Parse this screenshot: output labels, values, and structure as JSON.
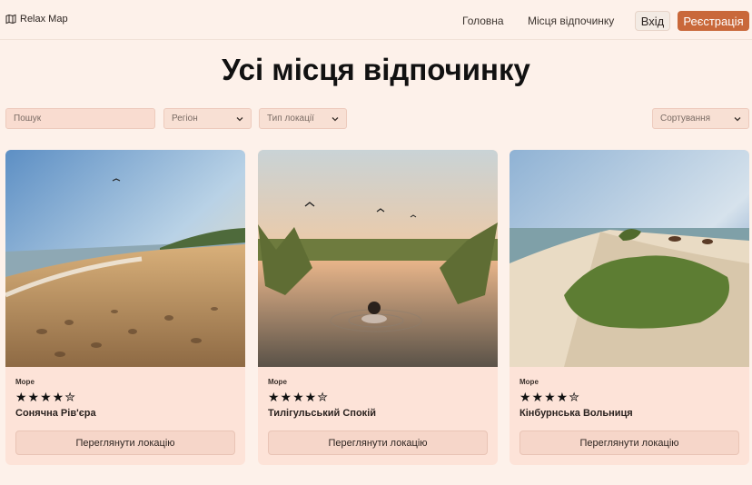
{
  "header": {
    "brand": "Relax Map",
    "nav": {
      "home": "Головна",
      "places": "Місця відпочинку"
    },
    "login": "Вхід",
    "register": "Реєстрація"
  },
  "page": {
    "title": "Усі місця відпочинку"
  },
  "filters": {
    "search_placeholder": "Пошук",
    "region": "Регіон",
    "location_type": "Тип локації",
    "sort": "Сортування"
  },
  "cards": [
    {
      "category": "Море",
      "stars": "★★★★✮",
      "name": "Сонячна Рів'єра",
      "button": "Переглянути локацію"
    },
    {
      "category": "Море",
      "stars": "★★★★✮",
      "name": "Тилігульський Спокій",
      "button": "Переглянути локацію"
    },
    {
      "category": "Море",
      "stars": "★★★★✮",
      "name": "Кінбурнська Вольниця",
      "button": "Переглянути локацію"
    }
  ],
  "colors": {
    "background": "#fdf1ea",
    "accent": "#c9683a",
    "card": "#fde3d8"
  }
}
